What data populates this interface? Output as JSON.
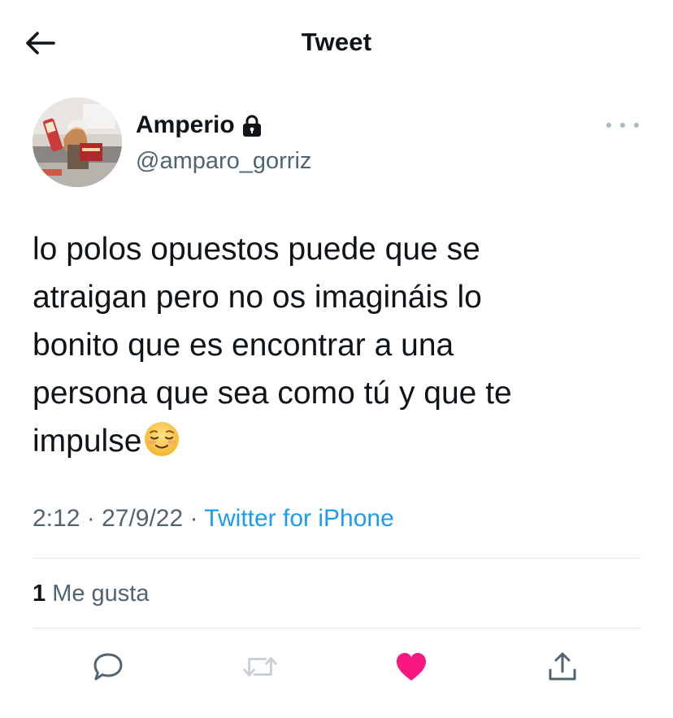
{
  "header": {
    "title": "Tweet"
  },
  "tweet": {
    "author": {
      "display_name": "Amperio",
      "handle": "@amparo_gorriz",
      "protected_icon": "lock-icon"
    },
    "text_lines": [
      "lo polos opuestos puede que se",
      "atraigan pero no os imagináis lo",
      "bonito que es encontrar a una",
      "persona que sea como tú y que te",
      "impulse"
    ],
    "emoji": "relieved-face",
    "time": "2:12",
    "date": "27/9/22",
    "separator": "·",
    "source": "Twitter for iPhone",
    "likes_count": "1",
    "likes_label": "Me gusta"
  },
  "actions": [
    {
      "name": "reply",
      "icon": "speech-bubble-icon"
    },
    {
      "name": "retweet",
      "icon": "retweet-icon",
      "state": "disabled"
    },
    {
      "name": "like",
      "icon": "heart-icon",
      "state": "liked"
    },
    {
      "name": "share",
      "icon": "share-icon"
    }
  ],
  "colors": {
    "text": "#0f1419",
    "secondary": "#536471",
    "link": "#1d9bf0",
    "like": "#f91880",
    "disabled": "#c5d0d8",
    "divider": "#dde3e8"
  }
}
